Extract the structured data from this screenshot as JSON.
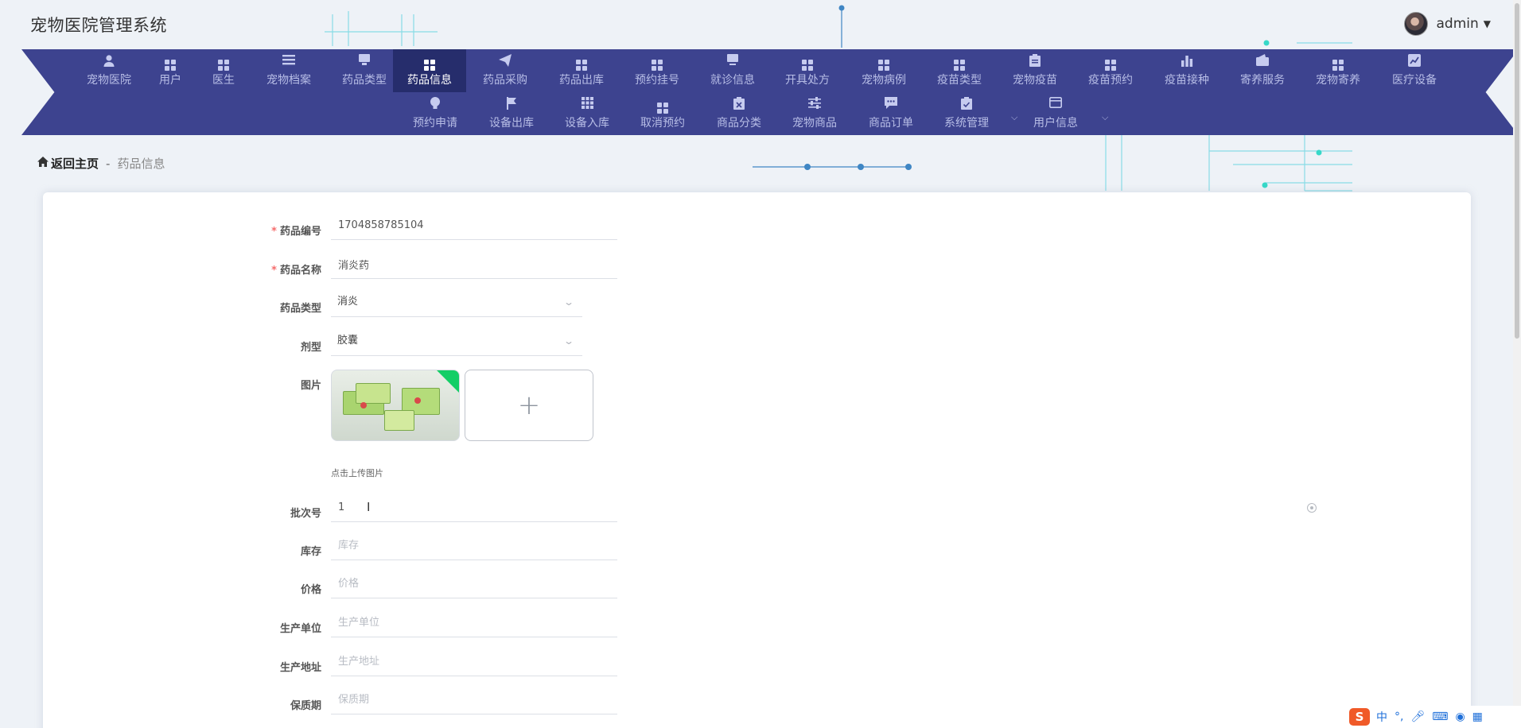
{
  "app": {
    "title": "宠物医院管理系统"
  },
  "user": {
    "name": "admin"
  },
  "nav": {
    "row1": [
      {
        "label": "宠物医院",
        "icon": "person-icon"
      },
      {
        "label": "用户",
        "icon": "grid-icon"
      },
      {
        "label": "医生",
        "icon": "grid-icon"
      },
      {
        "label": "宠物档案",
        "icon": "list-icon"
      },
      {
        "label": "药品类型",
        "icon": "monitor-icon"
      },
      {
        "label": "药品信息",
        "icon": "grid-icon",
        "active": true
      },
      {
        "label": "药品采购",
        "icon": "send-icon"
      },
      {
        "label": "药品出库",
        "icon": "grid-icon"
      },
      {
        "label": "预约挂号",
        "icon": "grid-icon"
      },
      {
        "label": "就诊信息",
        "icon": "desktop-icon"
      },
      {
        "label": "开具处方",
        "icon": "grid-icon"
      },
      {
        "label": "宠物病例",
        "icon": "grid-icon"
      },
      {
        "label": "疫苗类型",
        "icon": "grid-icon"
      },
      {
        "label": "宠物疫苗",
        "icon": "clipboard-icon"
      },
      {
        "label": "疫苗预约",
        "icon": "grid-icon"
      },
      {
        "label": "疫苗接种",
        "icon": "bar-chart-icon"
      },
      {
        "label": "寄养服务",
        "icon": "wallet-icon"
      },
      {
        "label": "宠物寄养",
        "icon": "grid-icon"
      },
      {
        "label": "医疗设备",
        "icon": "line-chart-icon"
      }
    ],
    "row2": [
      {
        "label": "预约申请",
        "icon": "bulb-icon"
      },
      {
        "label": "设备出库",
        "icon": "flag-icon"
      },
      {
        "label": "设备入库",
        "icon": "apps-icon"
      },
      {
        "label": "取消预约",
        "icon": "grid-icon"
      },
      {
        "label": "商品分类",
        "icon": "clipboard-x-icon"
      },
      {
        "label": "宠物商品",
        "icon": "sliders-icon"
      },
      {
        "label": "商品订单",
        "icon": "chat-icon"
      },
      {
        "label": "系统管理",
        "icon": "clipboard-check-icon",
        "dropdown": true
      },
      {
        "label": "用户信息",
        "icon": "card-icon",
        "dropdown": true
      }
    ]
  },
  "breadcrumb": {
    "home": "返回主页",
    "separator": "-",
    "current": "药品信息"
  },
  "form": {
    "code": {
      "label": "药品编号",
      "value": "1704858785104",
      "required": true
    },
    "name": {
      "label": "药品名称",
      "value": "消炎药",
      "required": true
    },
    "type": {
      "label": "药品类型",
      "value": "消炎"
    },
    "dosage": {
      "label": "剂型",
      "value": "胶囊"
    },
    "image": {
      "label": "图片",
      "hint": "点击上传图片"
    },
    "batch": {
      "label": "批次号",
      "value": "1"
    },
    "stock": {
      "label": "库存",
      "placeholder": "库存"
    },
    "price": {
      "label": "价格",
      "placeholder": "价格"
    },
    "maker": {
      "label": "生产单位",
      "placeholder": "生产单位"
    },
    "address": {
      "label": "生产地址",
      "placeholder": "生产地址"
    },
    "shelf": {
      "label": "保质期",
      "placeholder": "保质期"
    }
  },
  "tray": {
    "ime_lang": "中",
    "punct": "°,"
  }
}
